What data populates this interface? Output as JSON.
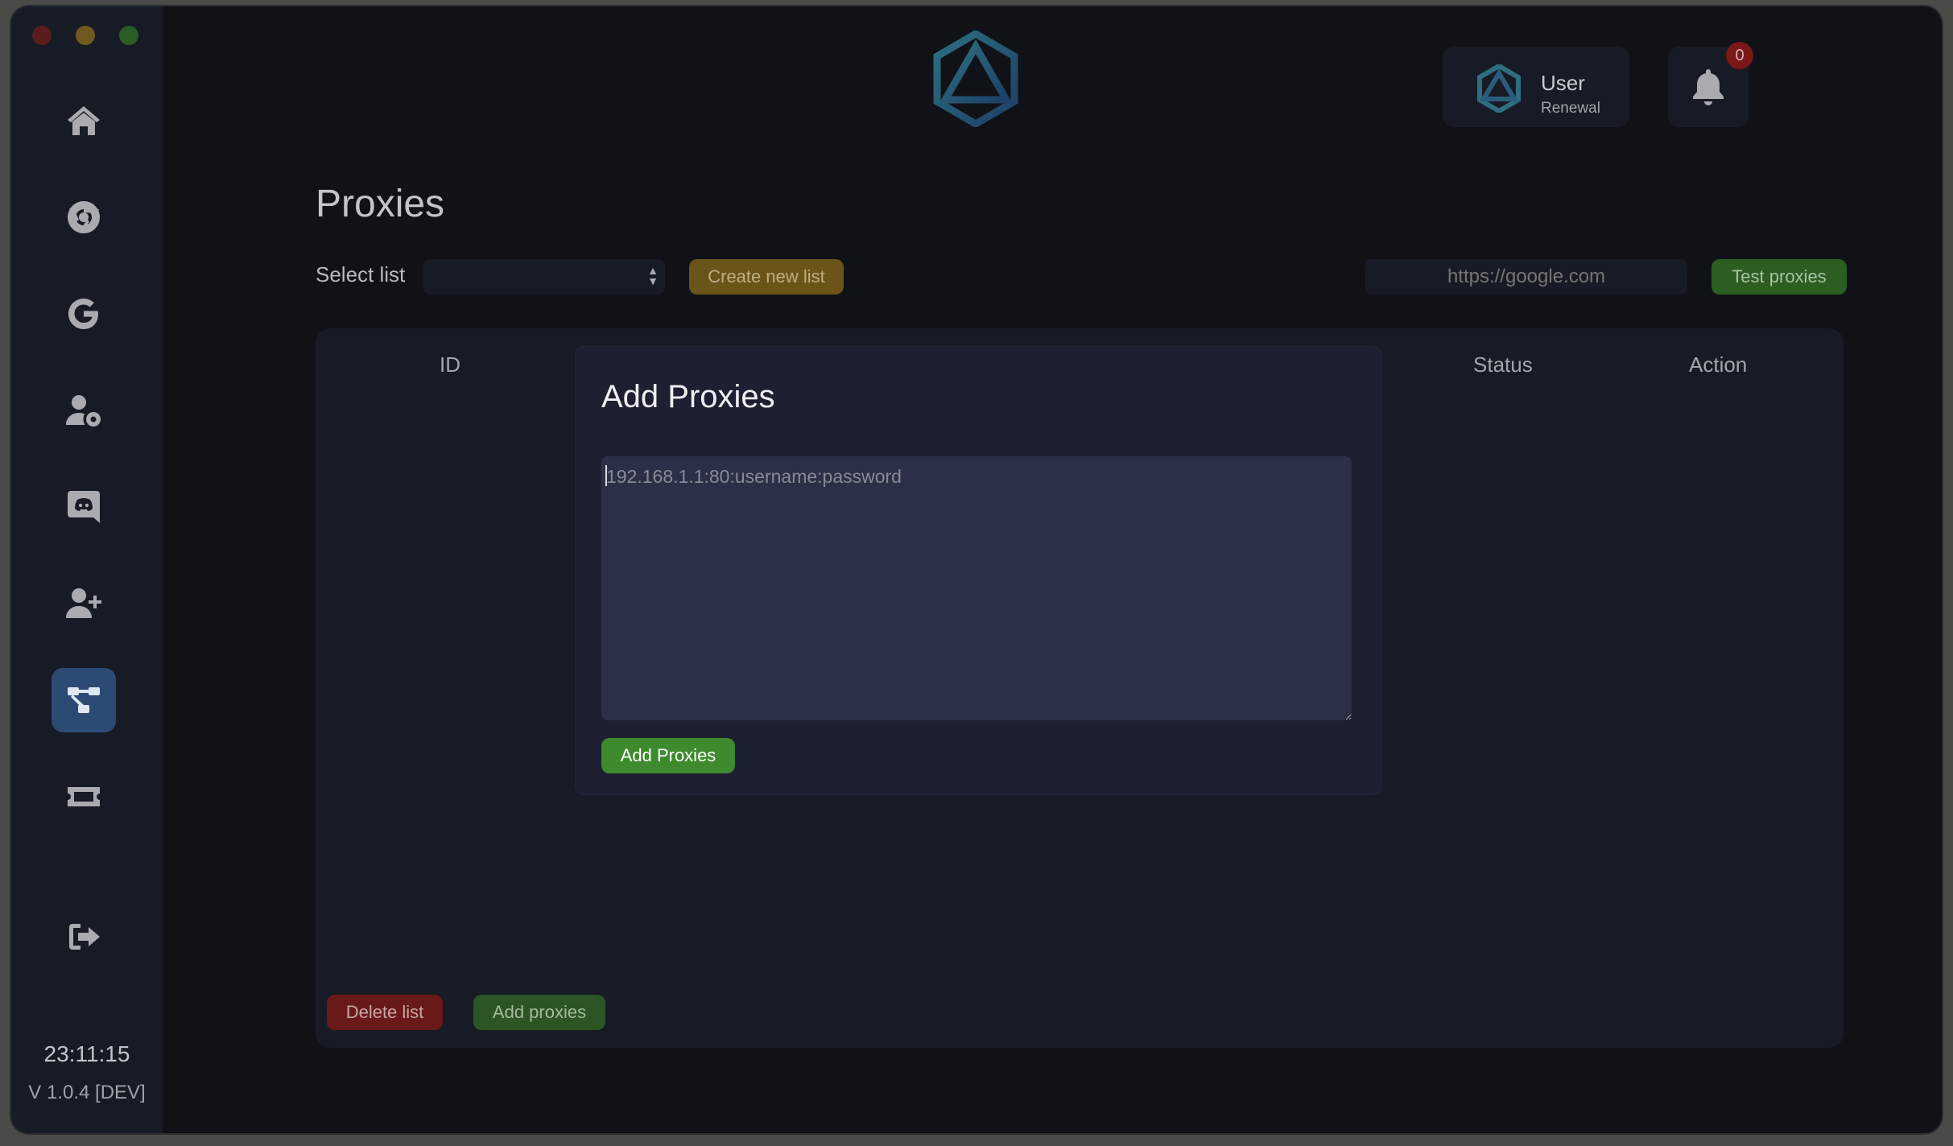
{
  "sidebar": {
    "items": [
      {
        "icon": "home-icon"
      },
      {
        "icon": "chrome-icon"
      },
      {
        "icon": "google-icon"
      },
      {
        "icon": "user-gear-icon"
      },
      {
        "icon": "discord-icon"
      },
      {
        "icon": "user-plus-icon"
      },
      {
        "icon": "network-icon",
        "active": true
      },
      {
        "icon": "ticket-icon"
      },
      {
        "icon": "sign-out-icon"
      }
    ],
    "clock": "23:11:15",
    "version": "V 1.0.4 [DEV]"
  },
  "header": {
    "user_name": "User",
    "user_sub": "Renewal",
    "notification_count": "0"
  },
  "page": {
    "title": "Proxies",
    "select_label": "Select list",
    "select_value": "",
    "create_label": "Create new list",
    "url_placeholder": "https://google.com",
    "test_label": "Test proxies"
  },
  "table": {
    "columns": [
      "ID",
      "Status",
      "Action"
    ],
    "delete_label": "Delete list",
    "add_label": "Add proxies"
  },
  "modal": {
    "title": "Add Proxies",
    "placeholder": "192.168.1.1:80:username:password",
    "button": "Add Proxies"
  },
  "colors": {
    "accent_active": "#2c4b74",
    "success": "#3e8a2e",
    "danger": "#6a1919",
    "warning": "#6b5418"
  }
}
